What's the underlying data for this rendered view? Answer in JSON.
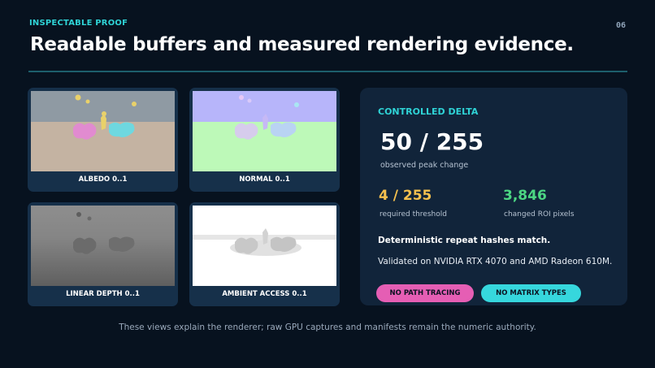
{
  "header": {
    "eyebrow": "INSPECTABLE PROOF",
    "page_number": "06",
    "title": "Readable buffers and measured rendering evidence."
  },
  "buffers": [
    {
      "caption": "ALBEDO 0..1"
    },
    {
      "caption": "NORMAL 0..1"
    },
    {
      "caption": "LINEAR DEPTH 0..1"
    },
    {
      "caption": "AMBIENT ACCESS 0..1"
    }
  ],
  "panel": {
    "label": "CONTROLLED DELTA",
    "peak_value": "50 / 255",
    "peak_caption": "observed peak change",
    "threshold_value": "4 / 255",
    "threshold_caption": "required threshold",
    "pixels_value": "3,846",
    "pixels_caption": "changed ROI pixels",
    "hash_note": "Deterministic repeat hashes match.",
    "validated_note": "Validated on NVIDIA RTX 4070 and AMD Radeon 610M.",
    "pill_left": "NO PATH TRACING",
    "pill_right": "NO MATRIX TYPES"
  },
  "footer": "These views explain the renderer; raw GPU captures and manifests remain the numeric authority.",
  "colors": {
    "background": "#07121f",
    "accent_cyan": "#2fd3d6",
    "threshold_yellow": "#f4c04e",
    "pixels_green": "#4cd683",
    "pill_pink": "#e55eb4",
    "pill_cyan": "#36d7dd"
  }
}
